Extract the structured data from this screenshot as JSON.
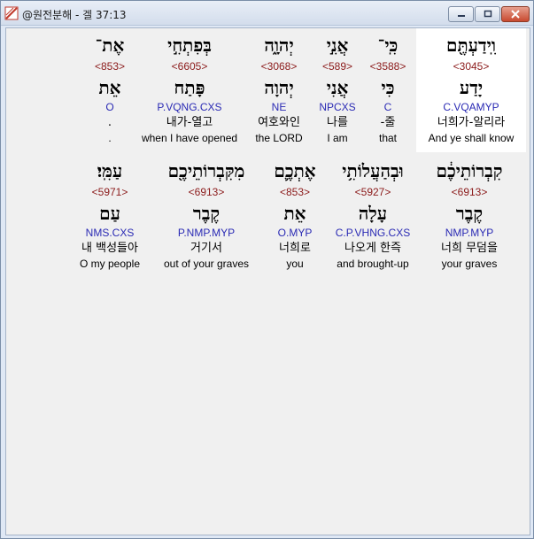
{
  "window": {
    "title": "@원전분해 - 겔 37:13",
    "icon": "app-diagonal-icon",
    "controls": {
      "minimize": "minimize-icon",
      "maximize": "maximize-icon",
      "close": "close-icon"
    }
  },
  "colors": {
    "strong": "#8b1a1a",
    "morph": "#2a2ab4",
    "highlight_bg": "#ffffff",
    "client_bg": "#f0f0f0"
  },
  "rows": [
    {
      "words": [
        {
          "surface": "וִֽידַעְתֶּ֖ם",
          "strong": "<3045>",
          "root": "יָדַע",
          "morph": "C.VQAMYP",
          "korean": "너희가-알리라",
          "english": "And ye shall know",
          "selected": true
        },
        {
          "surface": "כִּֽי־",
          "strong": "<3588>",
          "root": "כִּי",
          "morph": "C",
          "korean": "-줄",
          "english": "that"
        },
        {
          "surface": "אֲנִ֣י",
          "strong": "<589>",
          "root": "אֲנִי",
          "morph": "NPCXS",
          "korean": "나를",
          "english": "I am"
        },
        {
          "surface": "יְהוָ֑ה",
          "strong": "<3068>",
          "root": "יְהוָה",
          "morph": "NE",
          "korean": "여호와인",
          "english": "the LORD"
        },
        {
          "surface": "בְּפִתְחִ֣י",
          "strong": "<6605>",
          "root": "פָּתַח",
          "morph": "P.VQNG.CXS",
          "korean": "내가-열고",
          "english": "when I have opened"
        },
        {
          "surface": "אֶת־",
          "strong": "<853>",
          "root": "אֵת",
          "morph": "O",
          "korean": ".",
          "english": "."
        }
      ]
    },
    {
      "words": [
        {
          "surface": "קִבְרוֹתֵיכֶ֔ם",
          "strong": "<6913>",
          "root": "קֶבֶר",
          "morph": "NMP.MYP",
          "korean": "너희 무덤을",
          "english": "your graves"
        },
        {
          "surface": "וּבְהַעֲלוֹתִ֥י",
          "strong": "<5927>",
          "root": "עָלָה",
          "morph": "C.P.VHNG.CXS",
          "korean": "나오게 한즉",
          "english": "and brought-up"
        },
        {
          "surface": "אֶתְכֶ֛ם",
          "strong": "<853>",
          "root": "אֵת",
          "morph": "O.MYP",
          "korean": "너희로",
          "english": "you"
        },
        {
          "surface": "מִקִּבְרוֹתֵיכֶ֖ם",
          "strong": "<6913>",
          "root": "קֶבֶר",
          "morph": "P.NMP.MYP",
          "korean": "거기서",
          "english": "out of your graves"
        },
        {
          "surface": "עַמִּֽי׃",
          "strong": "<5971>",
          "root": "עַם",
          "morph": "NMS.CXS",
          "korean": "내 백성들아",
          "english": "O my people"
        }
      ]
    }
  ]
}
